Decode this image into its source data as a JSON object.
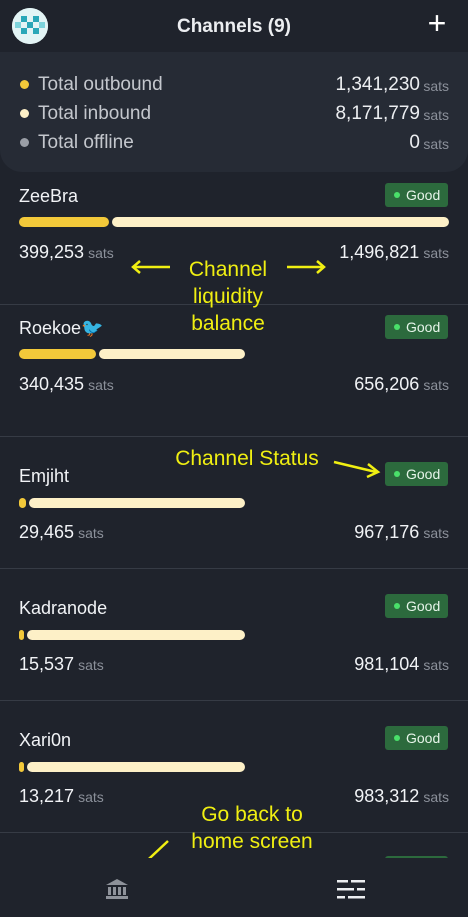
{
  "header": {
    "title": "Channels (9)",
    "add_icon": "plus-icon",
    "avatar_icon": "avatar-icon"
  },
  "summary": [
    {
      "label": "Total outbound",
      "value": "1,341,230",
      "unit": "sats",
      "color": "#f3c93a"
    },
    {
      "label": "Total inbound",
      "value": "8,171,779",
      "unit": "sats",
      "color": "#fdf0c7"
    },
    {
      "label": "Total offline",
      "value": "0",
      "unit": "sats",
      "color": "#9a9ea6"
    }
  ],
  "channels": [
    {
      "name": "ZeeBra",
      "status": "Good",
      "outbound": "399,253",
      "inbound": "1,496,821",
      "unit": "sats",
      "outbound_fraction": 0.21
    },
    {
      "name": "Roekoe🐦",
      "status": "Good",
      "outbound": "340,435",
      "inbound": "656,206",
      "unit": "sats",
      "outbound_fraction": 0.34
    },
    {
      "name": "Emjiht",
      "status": "Good",
      "outbound": "29,465",
      "inbound": "967,176",
      "unit": "sats",
      "outbound_fraction": 0.03
    },
    {
      "name": "Kadranode",
      "status": "Good",
      "outbound": "15,537",
      "inbound": "981,104",
      "unit": "sats",
      "outbound_fraction": 0.02
    },
    {
      "name": "Xari0n",
      "status": "Good",
      "outbound": "13,217",
      "inbound": "983,312",
      "unit": "sats",
      "outbound_fraction": 0.01
    }
  ],
  "annotations": {
    "liquidity": "Channel liquidity balance",
    "status": "Channel Status",
    "home": "Go back to home screen"
  },
  "nav": {
    "home_icon": "bank-icon",
    "list_icon": "channels-list-icon"
  },
  "colors": {
    "outbound": "#f3c93a",
    "inbound": "#fdf0c7",
    "good_badge": "#2c6a3d",
    "annotation": "#f0ef12"
  }
}
